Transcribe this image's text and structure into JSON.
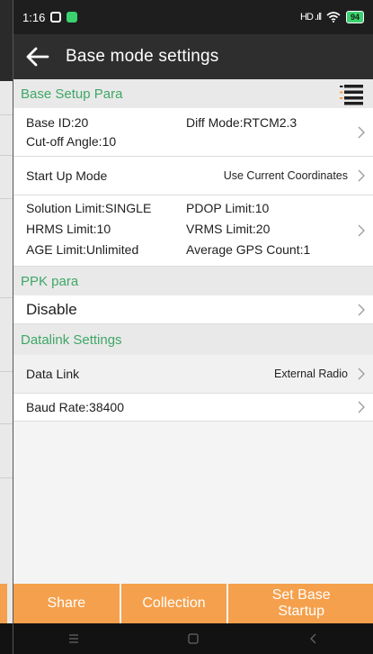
{
  "status": {
    "time": "1:16",
    "signal": "HD .ıll",
    "battery": "94"
  },
  "appbar": {
    "title": "Base mode settings"
  },
  "base_setup": {
    "header": "Base Setup Para",
    "base_id": "Base ID:20",
    "diff_mode": "Diff Mode:RTCM2.3",
    "cutoff": "Cut-off Angle:10",
    "startup_label": "Start Up Mode",
    "startup_value": "Use Current Coordinates",
    "solution_limit": "Solution Limit:SINGLE",
    "pdop_limit": "PDOP Limit:10",
    "hrms_limit": "HRMS Limit:10",
    "vrms_limit": "VRMS Limit:20",
    "age_limit": "AGE Limit:Unlimited",
    "avg_gps": "Average GPS Count:1"
  },
  "ppk": {
    "header": "PPK para",
    "value": "Disable"
  },
  "datalink": {
    "header": "Datalink Settings",
    "label": "Data Link",
    "value": "External Radio",
    "baud": "Baud Rate:38400"
  },
  "footer": {
    "share": "Share",
    "collection": "Collection",
    "set_base_startup": "Set Base Startup"
  },
  "colors": {
    "accent_green": "#3fa767",
    "button_orange": "#f5a04c",
    "appbar": "#2e2e2e"
  }
}
